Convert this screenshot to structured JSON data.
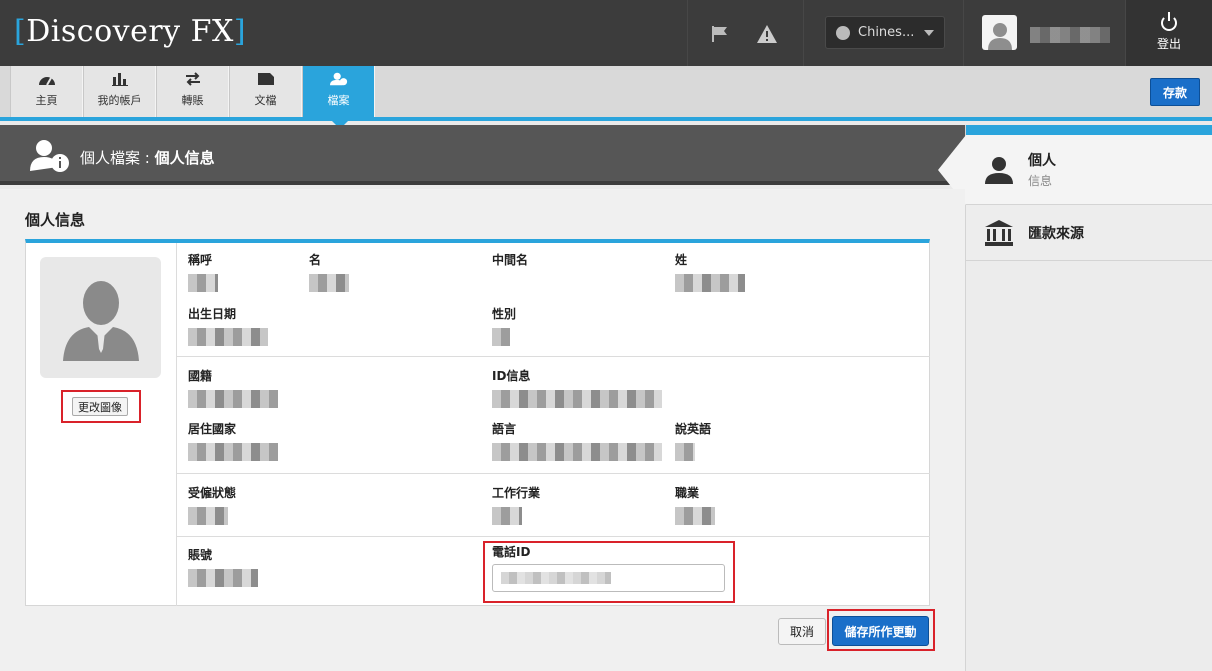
{
  "header": {
    "logo_bracket_open": "[",
    "logo_text": "Discovery FX",
    "logo_bracket_close": "]",
    "language": "Chines...",
    "logout_label": "登出",
    "accent": "#2aa4dc"
  },
  "nav": {
    "tabs": [
      {
        "label": "主頁",
        "icon": "dashboard-icon"
      },
      {
        "label": "我的帳戶",
        "icon": "bar-chart-icon"
      },
      {
        "label": "轉賬",
        "icon": "transfer-icon"
      },
      {
        "label": "文檔",
        "icon": "folder-icon"
      },
      {
        "label": "檔案",
        "icon": "profile-icon",
        "active": true
      }
    ],
    "deposit_label": "存款"
  },
  "titlebar": {
    "prefix": "個人檔案 : ",
    "current": "個人信息"
  },
  "sidebar": {
    "items": [
      {
        "label": "個人",
        "sub": "信息",
        "icon": "person-icon",
        "active": true
      },
      {
        "label": "匯款來源",
        "icon": "bank-icon"
      }
    ]
  },
  "main": {
    "section_title": "個人信息",
    "change_image_label": "更改圖像",
    "fields": {
      "title": "稱呼",
      "first_name": "名",
      "middle_name": "中間名",
      "last_name": "姓",
      "dob": "出生日期",
      "gender": "性別",
      "nationality": "國籍",
      "id_info": "ID信息",
      "residence": "居住國家",
      "language": "語言",
      "speaks_english": "說英語",
      "employment": "受僱狀態",
      "industry": "工作行業",
      "occupation": "職業",
      "account": "賬號",
      "phone_id": "電話ID"
    },
    "cancel_label": "取消",
    "save_label": "儲存所作更動"
  }
}
